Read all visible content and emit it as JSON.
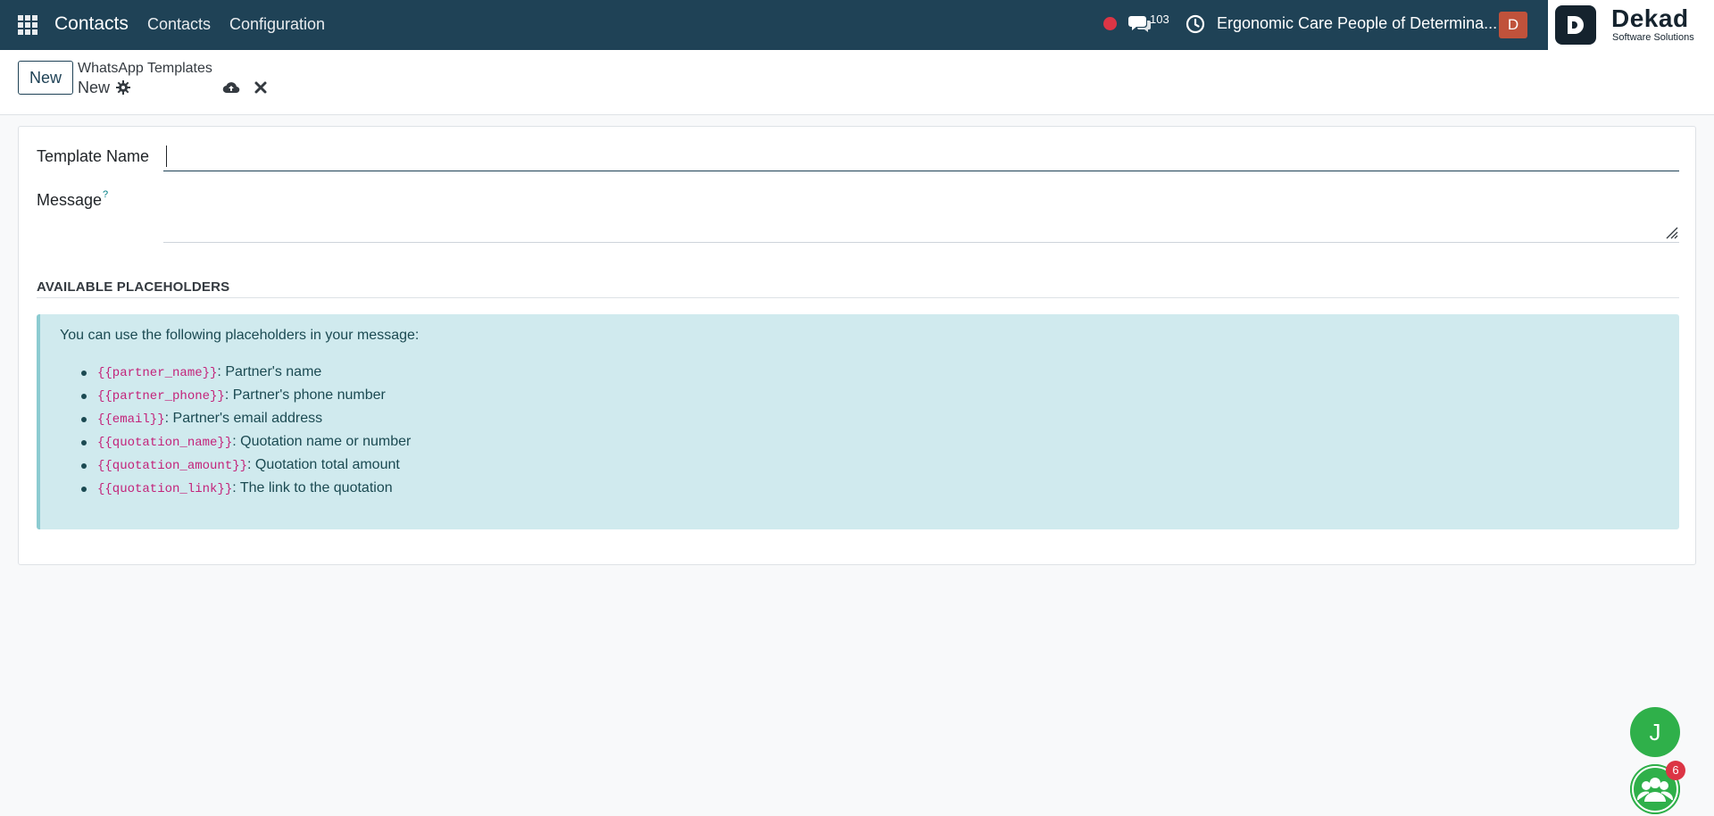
{
  "navbar": {
    "app_name": "Contacts",
    "menus": [
      "Contacts",
      "Configuration"
    ],
    "message_count": "103",
    "company_name": "Ergonomic Care People of Determina...",
    "user_initial": "D",
    "brand_color": "#1f4256"
  },
  "logo": {
    "title": "Dekad",
    "subtitle": "Software Solutions"
  },
  "control_panel": {
    "new_label": "New",
    "breadcrumb": "WhatsApp Templates",
    "record_name": "New"
  },
  "form": {
    "template_name_label": "Template Name",
    "template_name_value": "",
    "message_label": "Message",
    "help_mark": "?",
    "section_title": "AVAILABLE PLACEHOLDERS",
    "info_intro": "You can use the following placeholders in your message:",
    "placeholders": [
      {
        "code": "{{partner_name}}",
        "desc": ": Partner's name"
      },
      {
        "code": "{{partner_phone}}",
        "desc": ": Partner's phone number"
      },
      {
        "code": "{{email}}",
        "desc": ": Partner's email address"
      },
      {
        "code": "{{quotation_name}}",
        "desc": ": Quotation name or number"
      },
      {
        "code": "{{quotation_amount}}",
        "desc": ": Quotation total amount"
      },
      {
        "code": "{{quotation_link}}",
        "desc": ": The link to the quotation"
      }
    ]
  },
  "floating": {
    "user_bubble": "J",
    "chat_badge": "6"
  }
}
